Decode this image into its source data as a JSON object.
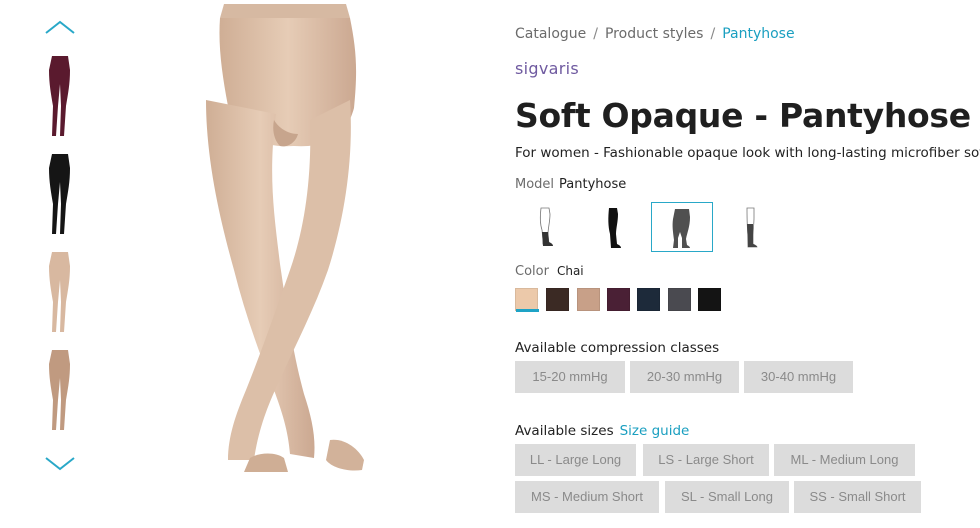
{
  "breadcrumb": {
    "items": [
      "Catalogue",
      "Product styles",
      "Pantyhose"
    ],
    "separator": "/"
  },
  "brand": "sigvaris",
  "product": {
    "title": "Soft Opaque - Pantyhose",
    "subtitle": "For women - Fashionable opaque look with long-lasting microfiber softness"
  },
  "model": {
    "label": "Model",
    "selected": "Pantyhose",
    "options": [
      {
        "icon": "thigh-high-outline-icon"
      },
      {
        "icon": "thigh-high-black-icon"
      },
      {
        "icon": "pantyhose-dark-icon",
        "selected": true
      },
      {
        "icon": "knee-high-icon"
      }
    ]
  },
  "color": {
    "label": "Color",
    "selected": "Chai",
    "swatches": [
      "#ecc9aa",
      "#3b2a24",
      "#c8a088",
      "#4a2035",
      "#1d2a3a",
      "#4a4a50",
      "#141414"
    ],
    "accent": "#1ea3c6"
  },
  "compression": {
    "label": "Available compression classes",
    "options": [
      "15-20 mmHg",
      "20-30 mmHg",
      "30-40 mmHg"
    ]
  },
  "sizes": {
    "label": "Available sizes",
    "guide_link": "Size guide",
    "options": [
      "LL - Large Long",
      "LS - Large Short",
      "ML - Medium Long",
      "MS - Medium Short",
      "SL - Small Long",
      "SS - Small Short"
    ]
  },
  "thumbnails": [
    {
      "color": "#5a1a2e",
      "name": "plum"
    },
    {
      "color": "#151515",
      "name": "black"
    },
    {
      "color": "#d8b8a0",
      "name": "nude"
    },
    {
      "color": "#c09a80",
      "name": "tan"
    }
  ],
  "colors": {
    "link": "#1a9fc0",
    "brand": "#6f5aa0",
    "button_bg": "#dcdcdc",
    "button_text": "#8a8a8a",
    "main_image": "#e0c4ad"
  }
}
